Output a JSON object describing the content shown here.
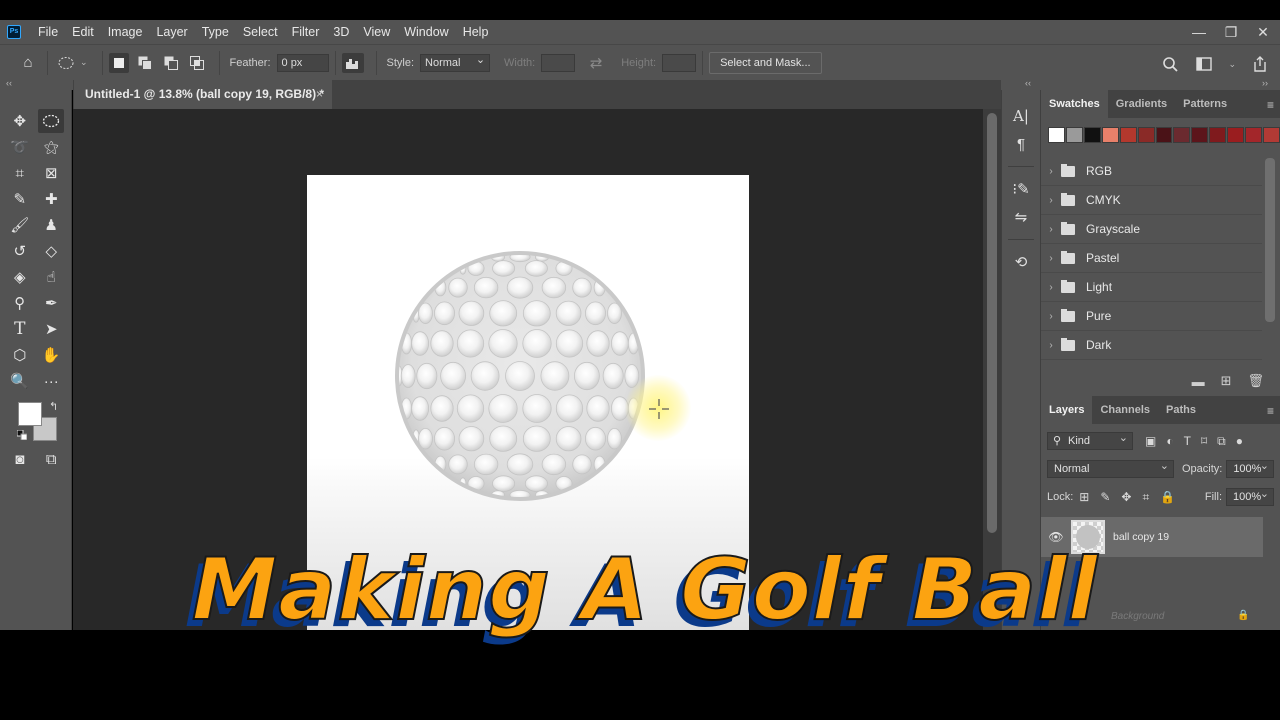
{
  "menu": {
    "items": [
      "File",
      "Edit",
      "Image",
      "Layer",
      "Type",
      "Select",
      "Filter",
      "3D",
      "View",
      "Window",
      "Help"
    ],
    "window_controls": [
      "—",
      "❐",
      "✕"
    ]
  },
  "options_bar": {
    "feather_label": "Feather:",
    "feather_value": "0 px",
    "style_label": "Style:",
    "style_value": "Normal",
    "width_label": "Width:",
    "height_label": "Height:",
    "select_mask_label": "Select and Mask..."
  },
  "document": {
    "tab_title": "Untitled-1 @ 13.8% (ball copy 19, RGB/8) *",
    "close_glyph": "×"
  },
  "swatches_panel": {
    "tabs": [
      "Swatches",
      "Gradients",
      "Patterns"
    ],
    "colors": [
      "#ffffff",
      "#9a9a9a",
      "#111111",
      "#e8806a",
      "#b3382d",
      "#8a2a27",
      "#4a1217",
      "#6b2a2f",
      "#5c151b",
      "#7f1a1d",
      "#9a1d1f",
      "#a3262a",
      "#b23a35"
    ],
    "folders": [
      "RGB",
      "CMYK",
      "Grayscale",
      "Pastel",
      "Light",
      "Pure",
      "Dark"
    ]
  },
  "layers_panel": {
    "tabs": [
      "Layers",
      "Channels",
      "Paths"
    ],
    "kind_label": "Kind",
    "blend_mode": "Normal",
    "opacity_label": "Opacity:",
    "opacity_value": "100%",
    "lock_label": "Lock:",
    "fill_label": "Fill:",
    "fill_value": "100%",
    "layer_name": "ball copy 19",
    "background_layer_name": "Background"
  },
  "overlay": {
    "title": "Making A Golf Ball",
    "color": "#fca311",
    "shadow_color": "#0b3a8a"
  }
}
